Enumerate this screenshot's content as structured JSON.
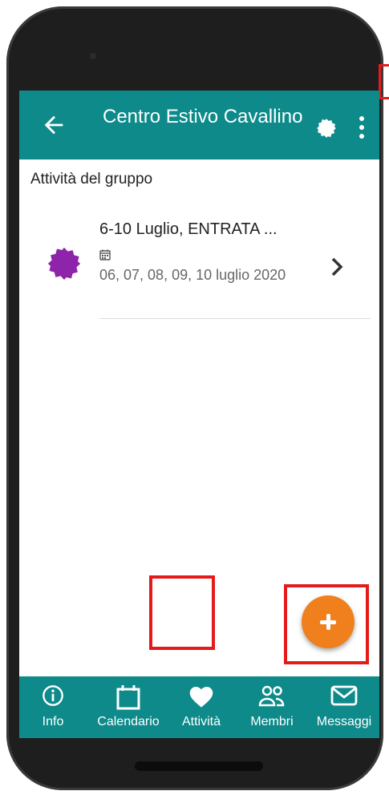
{
  "app": {
    "title": "Centro Estivo Cavallino",
    "header_icons": [
      "back-arrow-icon",
      "badge-icon",
      "more-vert-icon"
    ]
  },
  "section": {
    "title": "Attività del gruppo"
  },
  "activity": {
    "title": "6-10 Luglio, ENTRATA ...",
    "dates": "06, 07, 08, 09, 10 luglio 2020",
    "icon": "purple-badge-icon",
    "icon_color": "#8e24aa"
  },
  "fab": {
    "icon": "plus-icon",
    "color": "#f0801e"
  },
  "bottom_nav": {
    "items": [
      {
        "label": "Info",
        "icon": "info-icon"
      },
      {
        "label": "Calendario",
        "icon": "calendar-icon"
      },
      {
        "label": "Attività",
        "icon": "heart-icon"
      },
      {
        "label": "Membri",
        "icon": "people-icon"
      },
      {
        "label": "Messaggi",
        "icon": "mail-icon"
      }
    ],
    "selected": "Attività"
  },
  "colors": {
    "primary": "#0e8a8a",
    "highlight": "#e41b1b"
  }
}
